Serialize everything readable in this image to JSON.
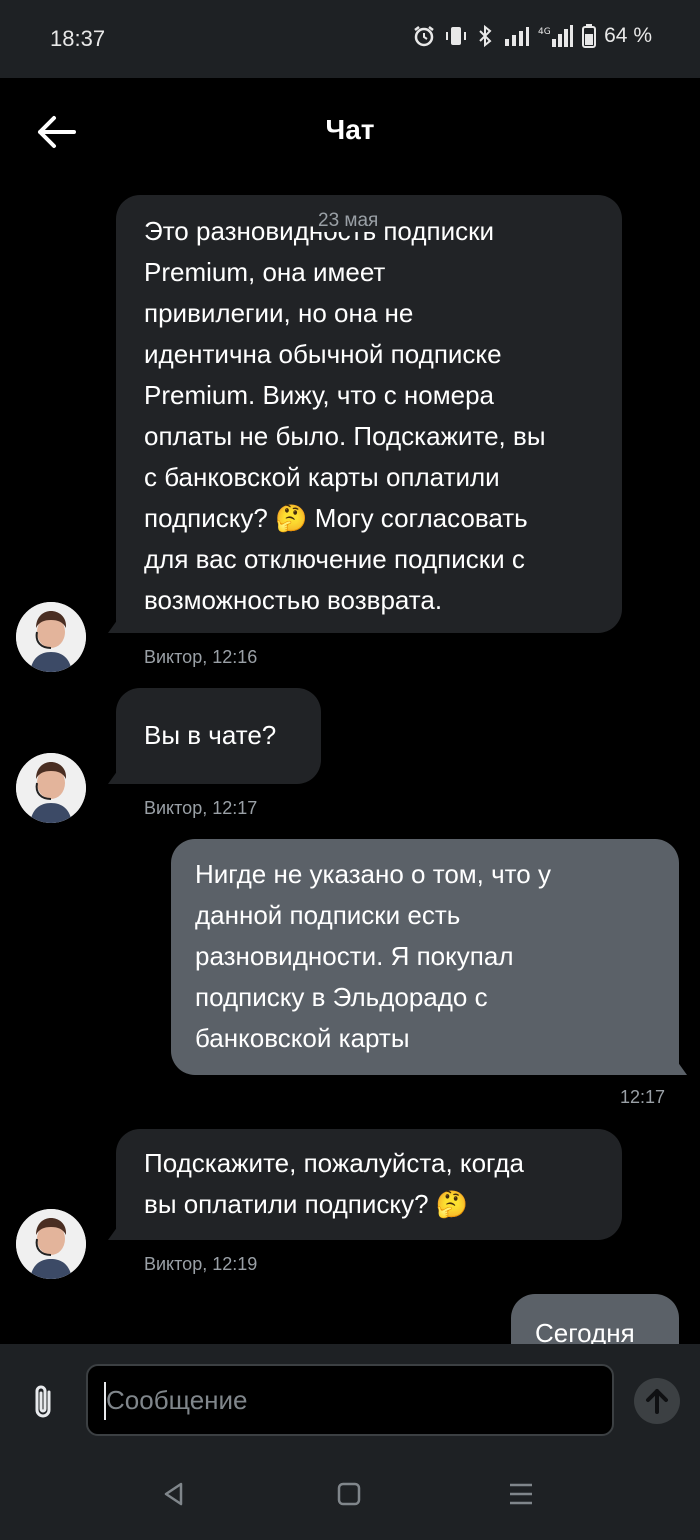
{
  "status_bar": {
    "time": "18:37",
    "battery": "64 %",
    "network": "4G"
  },
  "header": {
    "title": "Чат"
  },
  "chat": {
    "date_chip": "23 мая",
    "messages": [
      {
        "type": "incoming",
        "text": "Это разновидность подписки\n Premium, она имеет\nпривилегии, но она не\nидентична обычной подписке\n Premium. Вижу, что с номера\nоплаты не было. Подскажите, вы\nс банковской карты оплатили\nподписку? 🤔 Могу согласовать\nдля вас отключение подписки с\nвозможностью возврата.",
        "meta": "Виктор, 12:16"
      },
      {
        "type": "incoming",
        "text": "Вы в чате?",
        "meta": "Виктор, 12:17"
      },
      {
        "type": "outgoing",
        "text": "Нигде не указано о том, что у\nданной подписки есть\nразновидности. Я покупал\nподписку в Эльдорадо с\nбанковской карты",
        "meta": "12:17"
      },
      {
        "type": "incoming",
        "text": "Подскажите, пожалуйста, когда\nвы оплатили подписку? 🤔",
        "meta": "Виктор, 12:19"
      },
      {
        "type": "outgoing",
        "text": "Сегодня",
        "meta": ""
      }
    ]
  },
  "composer": {
    "placeholder": "Сообщение",
    "value": ""
  },
  "icons": {
    "back": "arrow-left-icon",
    "attach": "paperclip-icon",
    "send": "arrow-up-icon"
  },
  "colors": {
    "background": "#000000",
    "bar": "#1e2124",
    "incoming_bubble": "#212326",
    "outgoing_bubble": "#5b6168",
    "meta_text": "#9aa0a6"
  }
}
